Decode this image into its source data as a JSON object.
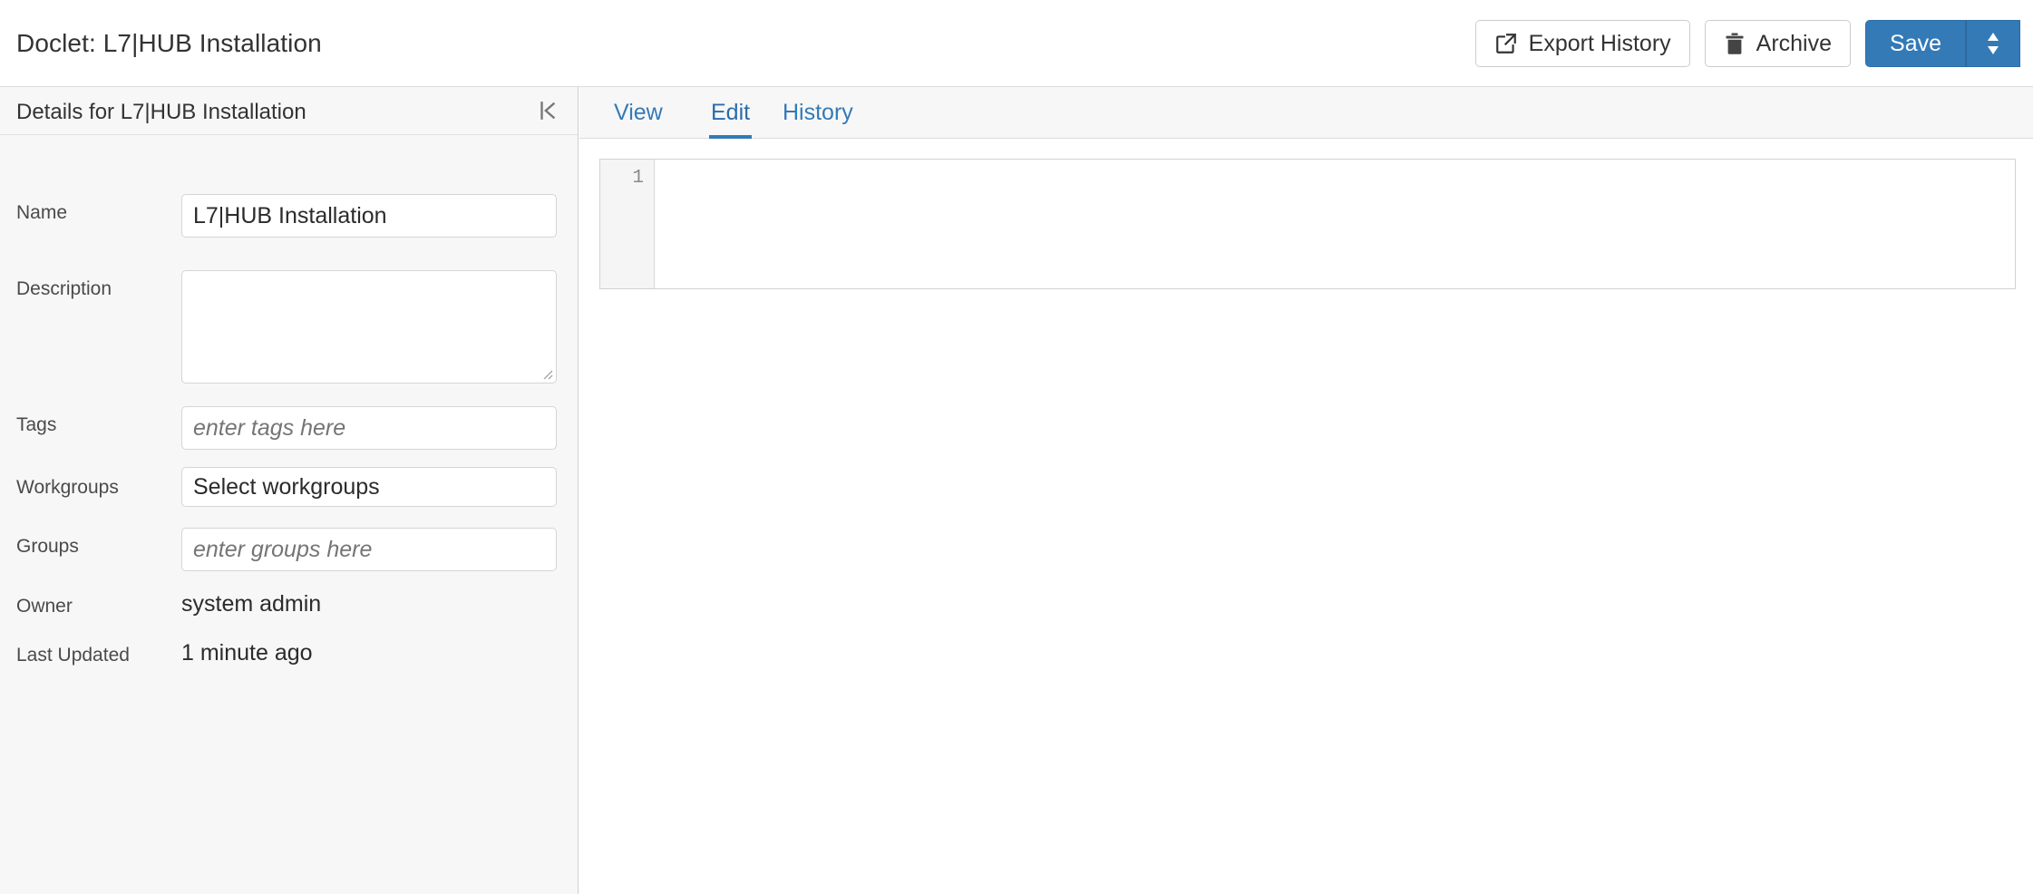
{
  "header": {
    "title": "Doclet: L7|HUB Installation",
    "actions": [
      {
        "id": "export-history",
        "label": "Export History",
        "icon": "external-link-icon"
      },
      {
        "id": "archive",
        "label": "Archive",
        "icon": "trash-icon"
      }
    ],
    "save": {
      "label": "Save",
      "icon": "sort-caret-icon",
      "color": "#337ab7"
    }
  },
  "sidebar": {
    "title": "Details for L7|HUB Installation",
    "collapse_icon": "collapse-panel-icon",
    "fields": [
      {
        "label": "Name",
        "type": "input",
        "value": "L7|HUB Installation",
        "placeholder": ""
      },
      {
        "label": "Description",
        "type": "textarea",
        "value": "",
        "placeholder": ""
      },
      {
        "label": "Tags",
        "type": "input",
        "value": "",
        "placeholder": "enter tags here"
      },
      {
        "label": "Workgroups",
        "type": "select",
        "value": "Select workgroups",
        "placeholder": ""
      },
      {
        "label": "Groups",
        "type": "input",
        "value": "",
        "placeholder": "enter groups here"
      },
      {
        "label": "Owner",
        "type": "static",
        "value": "system admin",
        "placeholder": ""
      },
      {
        "label": "Last Updated",
        "type": "static",
        "value": "1 minute ago",
        "placeholder": ""
      }
    ]
  },
  "main": {
    "tabs": [
      {
        "label": "View",
        "active": false
      },
      {
        "label": "Edit",
        "active": true
      },
      {
        "label": "History",
        "active": false
      }
    ],
    "editor": {
      "line_number": "1",
      "content": ""
    }
  },
  "colors": {
    "accent": "#337ab7",
    "panel_bg": "#f7f7f7",
    "border": "#dddddd"
  }
}
